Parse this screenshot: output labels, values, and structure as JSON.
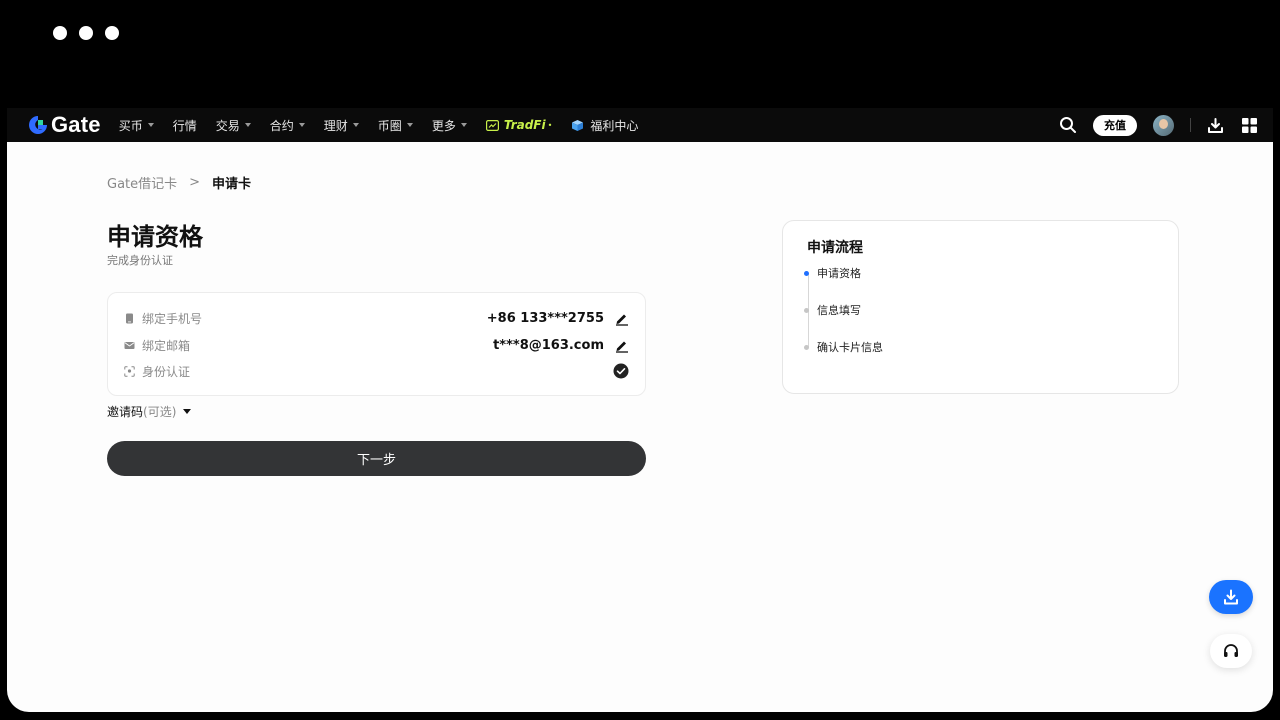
{
  "nav": {
    "logo_text": "Gate",
    "items": [
      {
        "label": "买币",
        "has_dropdown": true
      },
      {
        "label": "行情",
        "has_dropdown": false
      },
      {
        "label": "交易",
        "has_dropdown": true
      },
      {
        "label": "合约",
        "has_dropdown": true
      },
      {
        "label": "理财",
        "has_dropdown": true
      },
      {
        "label": "币圈",
        "has_dropdown": true
      },
      {
        "label": "更多",
        "has_dropdown": true
      }
    ],
    "tradfi_label": "TradFi",
    "welfare_label": "福利中心",
    "topup_label": "充值"
  },
  "breadcrumb": {
    "parent": "Gate借记卡",
    "separator": ">",
    "current": "申请卡"
  },
  "page": {
    "title": "申请资格",
    "subtitle": "完成身份认证"
  },
  "verification": {
    "phone": {
      "label": "绑定手机号",
      "value": "+86 133***2755"
    },
    "email": {
      "label": "绑定邮箱",
      "value": "t***8@163.com"
    },
    "identity": {
      "label": "身份认证",
      "status": "verified"
    }
  },
  "invite": {
    "label": "邀请码",
    "optional": "(可选)"
  },
  "next_button": "下一步",
  "process": {
    "title": "申请流程",
    "steps": [
      {
        "label": "申请资格",
        "active": true
      },
      {
        "label": "信息填写",
        "active": false
      },
      {
        "label": "确认卡片信息",
        "active": false
      }
    ]
  },
  "colors": {
    "accent": "#1f6fff",
    "tradfi": "#c8f04a",
    "primary_button": "#333436",
    "nav_bg": "#0b0b0b"
  }
}
